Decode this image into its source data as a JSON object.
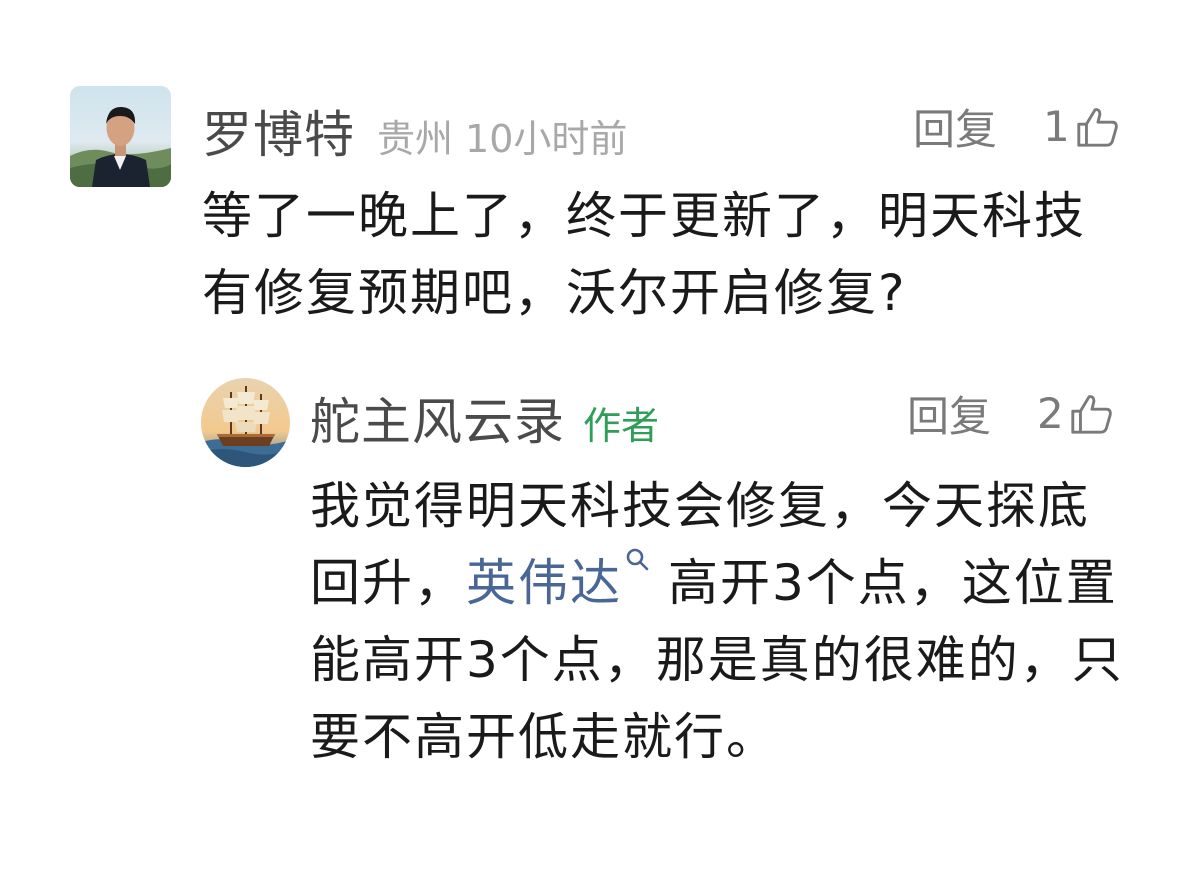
{
  "comments": [
    {
      "username": "罗博特",
      "location": "贵州",
      "time": "10小时前",
      "reply_label": "回复",
      "likes": "1",
      "avatar_icon": "user-photo",
      "text": "等了一晚上了，终于更新了，明天科技有修复预期吧，沃尔开启修复?"
    }
  ],
  "reply": {
    "username": "舵主风云录",
    "author_badge": "作者",
    "reply_label": "回复",
    "likes": "2",
    "avatar_icon": "sailing-ship",
    "text_before_link": "我觉得明天科技会修复，今天探底回升，",
    "stock_link": "英伟达",
    "text_after_link": "高开3个点，这位置能高开3个点，那是真的很难的，只要不高开低走就行。"
  },
  "colors": {
    "username": "#4a4a4a",
    "meta": "#a8a8a8",
    "author_badge": "#2f9e56",
    "link": "#4a6694",
    "body": "#1a1a1a",
    "action": "#7a7a7a"
  }
}
